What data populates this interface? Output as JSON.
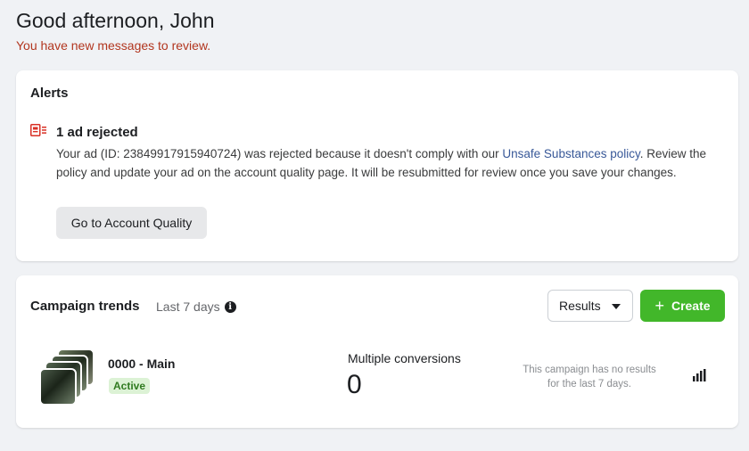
{
  "greeting": {
    "title": "Good afternoon, John",
    "subtitle": "You have new messages to review."
  },
  "alerts": {
    "title": "Alerts",
    "item": {
      "icon": "ad-rejected-icon",
      "title": "1 ad rejected",
      "body_before": "Your ad (ID: 23849917915940724) was rejected because it doesn't comply with our ",
      "link_text": "Unsafe Substances policy",
      "body_after": ". Review the policy and update your ad on the account quality page. It will be resubmitted for review once you save your changes.",
      "button_label": "Go to Account Quality"
    }
  },
  "trends": {
    "title": "Campaign trends",
    "range": "Last 7 days",
    "dropdown_value": "Results",
    "create_label": "Create",
    "campaign": {
      "name": "0000 - Main",
      "status": "Active",
      "metric_label": "Multiple conversions",
      "metric_value": "0",
      "note": "This campaign has no results for the last 7 days."
    }
  },
  "colors": {
    "accent_green": "#42b72a",
    "alert_red": "#b2361f",
    "link_blue": "#385898"
  }
}
